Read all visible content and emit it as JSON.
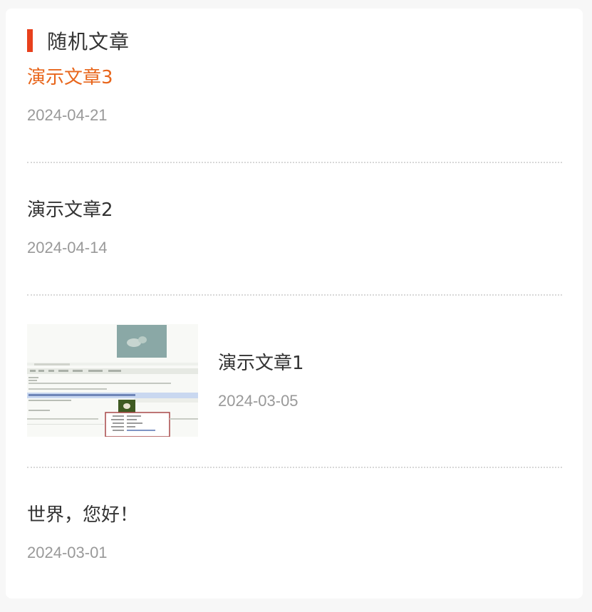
{
  "widget": {
    "title": "随机文章"
  },
  "posts": [
    {
      "title": "演示文章3",
      "date": "2024-04-21",
      "active": true,
      "has_thumbnail": false
    },
    {
      "title": "演示文章2",
      "date": "2024-04-14",
      "active": false,
      "has_thumbnail": false
    },
    {
      "title": "演示文章1",
      "date": "2024-03-05",
      "active": false,
      "has_thumbnail": true
    },
    {
      "title": "世界，您好！",
      "date": "2024-03-01",
      "active": false,
      "has_thumbnail": false
    }
  ],
  "colors": {
    "accent": "#e8401c",
    "active_link": "#e8661c",
    "text": "#333333",
    "muted": "#999999"
  }
}
